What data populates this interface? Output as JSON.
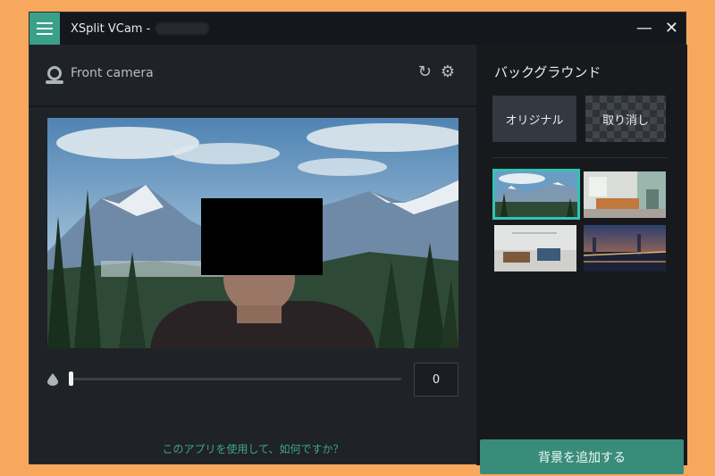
{
  "window": {
    "title": "XSplit VCam -",
    "minimize_glyph": "—",
    "close_glyph": "✕"
  },
  "camera": {
    "label": "Front camera",
    "refresh_glyph": "↻",
    "settings_glyph": "⚙"
  },
  "blur_slider": {
    "value": 0,
    "value_text": "0"
  },
  "feedback_link": "このアプリを使用して、如何ですか？",
  "background_panel": {
    "title": "バックグラウンド",
    "original_button": "オリジナル",
    "cancel_button": "取り消し",
    "thumbnails": [
      {
        "name": "mountains",
        "selected": true
      },
      {
        "name": "living-room",
        "selected": false
      },
      {
        "name": "desk-room",
        "selected": false
      },
      {
        "name": "city-bridge-night",
        "selected": false
      }
    ],
    "add_button": "背景を追加する"
  },
  "colors": {
    "accent": "#3aa08a",
    "selected_border": "#33c3b2",
    "link": "#3ea493"
  }
}
